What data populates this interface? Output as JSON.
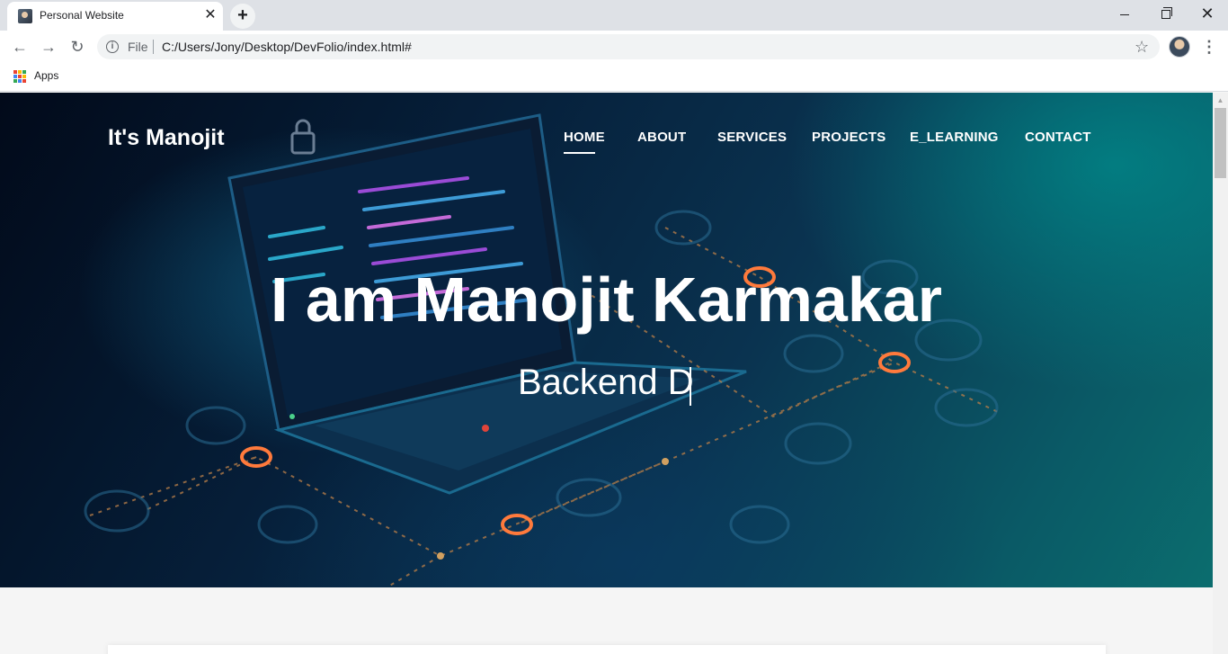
{
  "browser": {
    "tab": {
      "title": "Personal Website",
      "close_glyph": "✕"
    },
    "new_tab_glyph": "+",
    "window_controls": {
      "close_glyph": "✕"
    },
    "toolbar": {
      "back_glyph": "←",
      "forward_glyph": "→",
      "reload_glyph": "↻",
      "info_glyph": "i",
      "scheme_label": "File",
      "url": "C:/Users/Jony/Desktop/DevFolio/index.html#",
      "star_glyph": "☆",
      "menu_glyph": "⋮"
    },
    "bookmarks": {
      "apps_label": "Apps"
    },
    "icons": [
      "favicon",
      "close-icon",
      "plus-icon",
      "minimize-icon",
      "maximize-icon",
      "back-arrow-icon",
      "forward-arrow-icon",
      "reload-icon",
      "info-icon",
      "star-icon",
      "profile-avatar",
      "kebab-menu-icon",
      "apps-grid-icon"
    ]
  },
  "site": {
    "brand": "It's Manojit",
    "nav": [
      {
        "label": "HOME",
        "active": true
      },
      {
        "label": "ABOUT",
        "active": false
      },
      {
        "label": "SERVICES",
        "active": false
      },
      {
        "label": "PROJECTS",
        "active": false
      },
      {
        "label": "E_LEARNING",
        "active": false
      },
      {
        "label": "CONTACT",
        "active": false
      }
    ],
    "hero": {
      "title": "I am Manojit Karmakar",
      "typed_text": "Backend D"
    }
  },
  "colors": {
    "accent_text": "#ffffff",
    "hero_dark": "#020a1a",
    "hero_teal": "#0b6d6e",
    "node_orange": "#ff7a3c",
    "chrome_bg": "#dee1e6"
  }
}
